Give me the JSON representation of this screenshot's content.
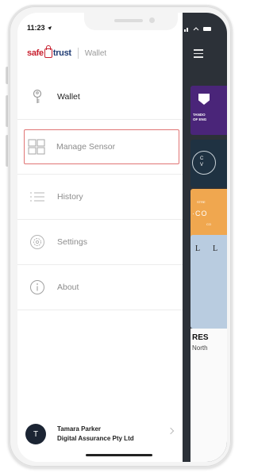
{
  "status": {
    "time": "11:23"
  },
  "header": {
    "logo_safe": "safe",
    "logo_trust": "trust",
    "title": "Wallet"
  },
  "menu": {
    "items": [
      {
        "label": "Wallet",
        "icon": "key-icon"
      },
      {
        "label": "Manage Sensor",
        "icon": "grid-icon"
      },
      {
        "label": "History",
        "icon": "list-icon"
      },
      {
        "label": "Settings",
        "icon": "gear-icon"
      },
      {
        "label": "About",
        "icon": "info-icon"
      }
    ]
  },
  "profile": {
    "initial": "T",
    "name": "Tamara Parker",
    "org": "Digital Assurance Pty Ltd"
  },
  "background": {
    "card1_text": [
      "TANDO",
      "OF ENG"
    ],
    "card2_text": [
      "C",
      "V"
    ],
    "card3_text": [
      "STRE",
      "·CO",
      "CO"
    ],
    "card4_text": [
      "L",
      "L"
    ],
    "res_title": "RES",
    "res_sub": "North"
  },
  "colors": {
    "accent": "#c8202f",
    "brand_dark": "#1f3b73",
    "selection_border": "#e07575",
    "panel_dark": "#2c3138"
  }
}
